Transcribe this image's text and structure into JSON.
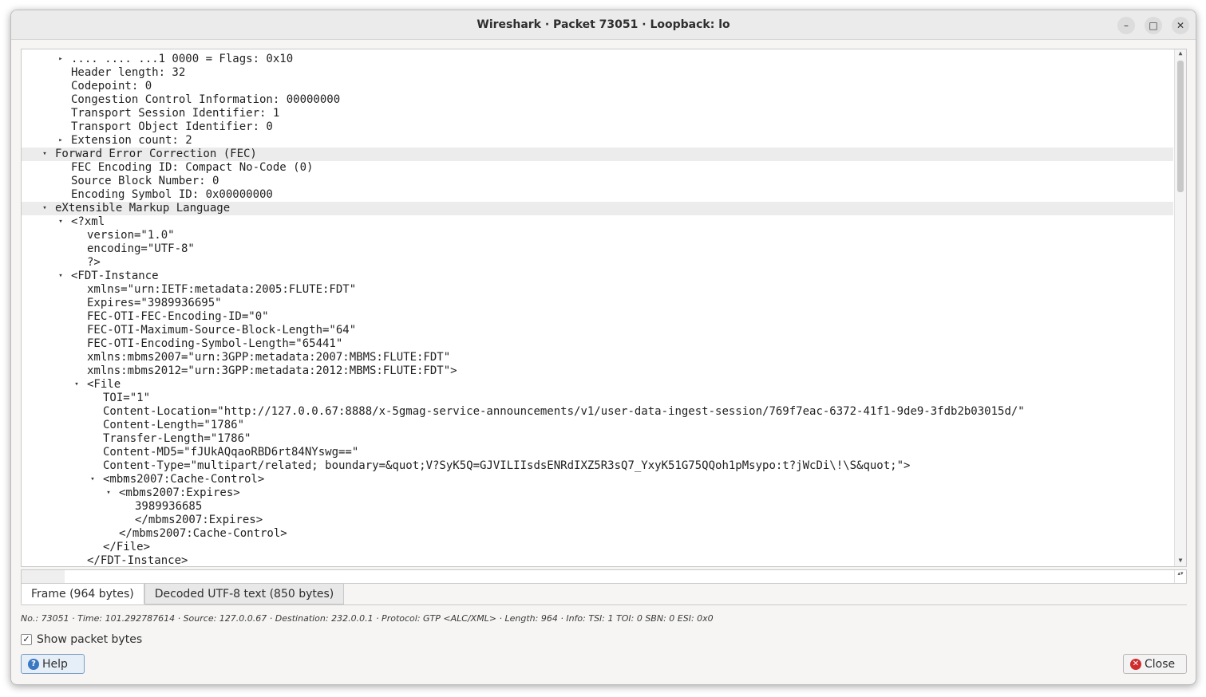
{
  "window": {
    "title": "Wireshark · Packet 73051 · Loopback: lo",
    "minimize_icon": "minimize-icon",
    "maximize_icon": "maximize-icon",
    "close_icon": "close-icon"
  },
  "tree": {
    "rows": [
      {
        "text": ".... .... ...1 0000 = Flags: 0x10",
        "arrow": "collapsed"
      },
      {
        "text": "Header length: 32",
        "arrow": "none"
      },
      {
        "text": "Codepoint: 0",
        "arrow": "none"
      },
      {
        "text": "Congestion Control Information: 00000000",
        "arrow": "none"
      },
      {
        "text": "Transport Session Identifier: 1",
        "arrow": "none"
      },
      {
        "text": "Transport Object Identifier: 0",
        "arrow": "none"
      },
      {
        "text": "Extension count: 2",
        "arrow": "collapsed"
      },
      {
        "text": "Forward Error Correction (FEC)",
        "arrow": "expanded"
      },
      {
        "text": "FEC Encoding ID: Compact No-Code (0)",
        "arrow": "none"
      },
      {
        "text": "Source Block Number: 0",
        "arrow": "none"
      },
      {
        "text": "Encoding Symbol ID: 0x00000000",
        "arrow": "none"
      },
      {
        "text": "eXtensible Markup Language",
        "arrow": "expanded"
      },
      {
        "text": "<?xml",
        "arrow": "expanded"
      },
      {
        "text": "version=\"1.0\"",
        "arrow": "none"
      },
      {
        "text": "encoding=\"UTF-8\"",
        "arrow": "none"
      },
      {
        "text": "?>",
        "arrow": "none"
      },
      {
        "text": "<FDT-Instance",
        "arrow": "expanded"
      },
      {
        "text": "xmlns=\"urn:IETF:metadata:2005:FLUTE:FDT\"",
        "arrow": "none"
      },
      {
        "text": "Expires=\"3989936695\"",
        "arrow": "none"
      },
      {
        "text": "FEC-OTI-FEC-Encoding-ID=\"0\"",
        "arrow": "none"
      },
      {
        "text": "FEC-OTI-Maximum-Source-Block-Length=\"64\"",
        "arrow": "none"
      },
      {
        "text": "FEC-OTI-Encoding-Symbol-Length=\"65441\"",
        "arrow": "none"
      },
      {
        "text": "xmlns:mbms2007=\"urn:3GPP:metadata:2007:MBMS:FLUTE:FDT\"",
        "arrow": "none"
      },
      {
        "text": "xmlns:mbms2012=\"urn:3GPP:metadata:2012:MBMS:FLUTE:FDT\">",
        "arrow": "none"
      },
      {
        "text": "<File",
        "arrow": "expanded"
      },
      {
        "text": "TOI=\"1\"",
        "arrow": "none"
      },
      {
        "text": "Content-Location=\"http://127.0.0.67:8888/x-5gmag-service-announcements/v1/user-data-ingest-session/769f7eac-6372-41f1-9de9-3fdb2b03015d/\"",
        "arrow": "none"
      },
      {
        "text": "Content-Length=\"1786\"",
        "arrow": "none"
      },
      {
        "text": "Transfer-Length=\"1786\"",
        "arrow": "none"
      },
      {
        "text": "Content-MD5=\"fJUkAQqaoRBD6rt84NYswg==\"",
        "arrow": "none"
      },
      {
        "text": "Content-Type=\"multipart/related; boundary=&quot;V?SyK5Q=GJVILIIsdsENRdIXZ5R3sQ7_YxyK51G75QQoh1pMsypo:t?jWcDi\\!\\S&quot;\">",
        "arrow": "none"
      },
      {
        "text": "<mbms2007:Cache-Control>",
        "arrow": "expanded"
      },
      {
        "text": "<mbms2007:Expires>",
        "arrow": "expanded"
      },
      {
        "text": "3989936685",
        "arrow": "none"
      },
      {
        "text": "</mbms2007:Expires>",
        "arrow": "none"
      },
      {
        "text": "</mbms2007:Cache-Control>",
        "arrow": "none"
      },
      {
        "text": "</File>",
        "arrow": "none"
      },
      {
        "text": "</FDT-Instance>",
        "arrow": "none"
      }
    ]
  },
  "tabs": [
    {
      "label": "Frame (964 bytes)",
      "active": true
    },
    {
      "label": "Decoded UTF-8 text (850 bytes)",
      "active": false
    }
  ],
  "status": {
    "info": "No.: 73051 · Time: 101.292787614 · Source: 127.0.0.67 · Destination: 232.0.0.1 · Protocol: GTP <ALC/XML> · Length: 964 · Info: TSI: 1 TOI: 0 SBN: 0 ESI: 0x0"
  },
  "options": {
    "show_bytes_label": "Show packet bytes",
    "show_bytes_checked": true
  },
  "buttons": {
    "help_label": "Help",
    "close_label": "Close"
  }
}
